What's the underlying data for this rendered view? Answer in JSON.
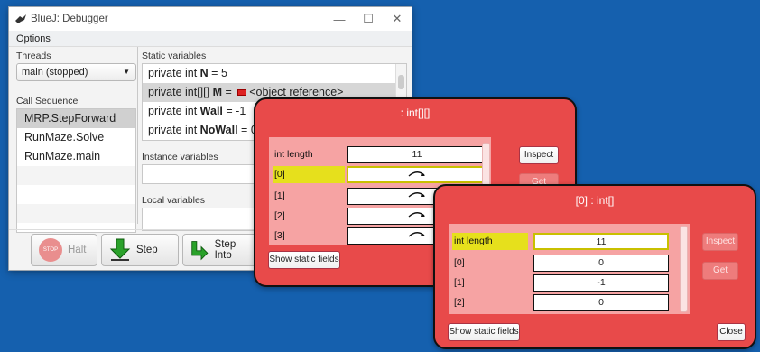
{
  "debugger": {
    "title": "BlueJ: Debugger",
    "menu": {
      "options": "Options"
    },
    "threads_label": "Threads",
    "thread_selected": "main (stopped)",
    "callseq_label": "Call Sequence",
    "callseq": [
      "MRP.StepForward",
      "RunMaze.Solve",
      "RunMaze.main"
    ],
    "static_label": "Static variables",
    "static_vars": [
      {
        "prefix": "private int ",
        "name": "N",
        "suffix": " = 5"
      },
      {
        "prefix": "private int[][] ",
        "name": "M",
        "suffix": " = ",
        "ref": "<object reference>"
      },
      {
        "prefix": "private int ",
        "name": "Wall",
        "suffix": " = -1"
      },
      {
        "prefix": "private int ",
        "name": "NoWall",
        "suffix": " = 0"
      }
    ],
    "instance_label": "Instance variables",
    "local_label": "Local variables",
    "buttons": {
      "halt": "Halt",
      "halt_icon_text": "STOP",
      "step": "Step",
      "step_into": "Step Into"
    }
  },
  "inspector1": {
    "title": ": int[][]",
    "rows": [
      {
        "key": "int length",
        "value": "11"
      },
      {
        "key": "[0]",
        "value": ""
      },
      {
        "key": "[1]",
        "value": ""
      },
      {
        "key": "[2]",
        "value": ""
      },
      {
        "key": "[3]",
        "value": ""
      }
    ],
    "inspect": "Inspect",
    "get": "Get",
    "show_static": "Show static fields"
  },
  "inspector2": {
    "title": "[0] : int[]",
    "rows": [
      {
        "key": "int length",
        "value": "11"
      },
      {
        "key": "[0]",
        "value": "0"
      },
      {
        "key": "[1]",
        "value": "-1"
      },
      {
        "key": "[2]",
        "value": "0"
      }
    ],
    "inspect": "Inspect",
    "get": "Get",
    "show_static": "Show static fields",
    "close": "Close"
  },
  "colors": {
    "desktop": "#1560ae",
    "inspector": "#e84a4a",
    "inspector_panel": "#f6a3a3",
    "highlight": "#e6e01c"
  }
}
